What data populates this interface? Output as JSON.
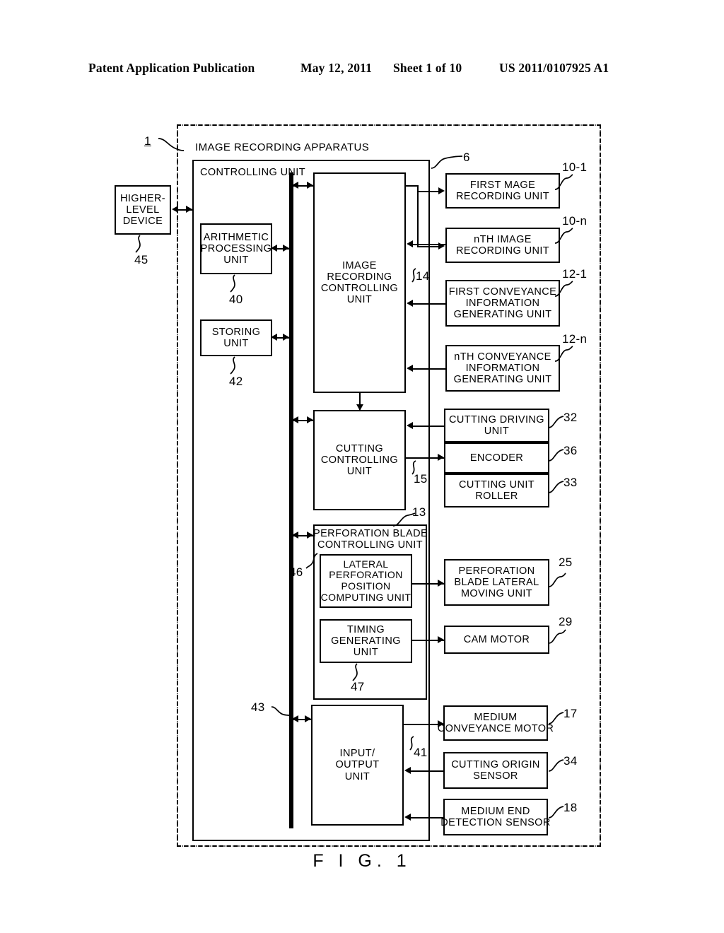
{
  "header": {
    "title": "Patent Application Publication",
    "date": "May 12, 2011",
    "sheet": "Sheet 1 of 10",
    "patent_number": "US 2011/0107925 A1"
  },
  "figure": {
    "caption": "F I G.  1",
    "apparatus_label": "IMAGE RECORDING APPARATUS",
    "apparatus_ref": "1",
    "controlling_unit_label": "CONTROLLING UNIT",
    "controlling_unit_ref": "6",
    "bus_ref": "43"
  },
  "blocks": {
    "higher_level_device": {
      "label": "HIGHER-\nLEVEL\nDEVICE",
      "ref": "45"
    },
    "arithmetic_processing_unit": {
      "label": "ARITHMETIC\nPROCESSING\nUNIT",
      "ref": "40"
    },
    "storing_unit": {
      "label": "STORING\nUNIT",
      "ref": "42"
    },
    "image_recording_controlling_unit": {
      "label": "IMAGE\nRECORDING\nCONTROLLING\nUNIT",
      "ref": "14"
    },
    "cutting_controlling_unit": {
      "label": "CUTTING\nCONTROLLING\nUNIT",
      "ref": "15"
    },
    "perforation_blade_controlling_unit": {
      "label": "PERFORATION BLADE\nCONTROLLING UNIT",
      "ref": "13",
      "ref_side": "46"
    },
    "lateral_perforation_position_computing_unit": {
      "label": "LATERAL\nPERFORATION\nPOSITION\nCOMPUTING UNIT"
    },
    "timing_generating_unit": {
      "label": "TIMING\nGENERATING\nUNIT",
      "ref": "47"
    },
    "input_output_unit": {
      "label": "INPUT/\nOUTPUT\nUNIT",
      "ref": "41"
    },
    "first_image_recording_unit": {
      "label": "FIRST MAGE\nRECORDING UNIT",
      "ref": "10-1"
    },
    "nth_image_recording_unit": {
      "label": "nTH IMAGE\nRECORDING UNIT",
      "ref": "10-n"
    },
    "first_conveyance_information_generating_unit": {
      "label": "FIRST CONVEYANCE\nINFORMATION\nGENERATING UNIT",
      "ref": "12-1"
    },
    "nth_conveyance_information_generating_unit": {
      "label": "nTH CONVEYANCE\nINFORMATION\nGENERATING UNIT",
      "ref": "12-n"
    },
    "cutting_driving_unit": {
      "label": "CUTTING DRIVING\nUNIT",
      "ref": "32"
    },
    "encoder": {
      "label": "ENCODER",
      "ref": "36"
    },
    "cutting_unit_roller": {
      "label": "CUTTING UNIT\nROLLER",
      "ref": "33"
    },
    "perforation_blade_lateral_moving_unit": {
      "label": "PERFORATION\nBLADE LATERAL\nMOVING UNIT",
      "ref": "25"
    },
    "cam_motor": {
      "label": "CAM MOTOR",
      "ref": "29"
    },
    "medium_conveyance_motor": {
      "label": "MEDIUM\nCONVEYANCE MOTOR",
      "ref": "17"
    },
    "cutting_origin_sensor": {
      "label": "CUTTING ORIGIN\nSENSOR",
      "ref": "34"
    },
    "medium_end_detection_sensor": {
      "label": "MEDIUM END\nDETECTION SENSOR",
      "ref": "18"
    }
  },
  "colors": {
    "ink": "#000000",
    "paper": "#ffffff"
  }
}
